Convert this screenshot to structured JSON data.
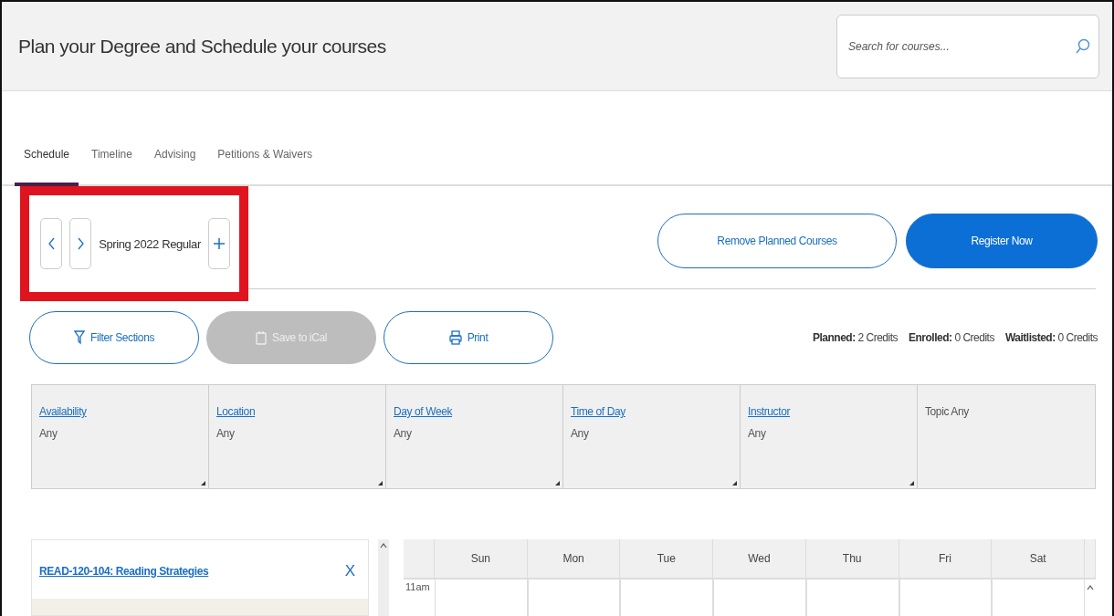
{
  "header": {
    "title": "Plan your Degree and Schedule your courses",
    "search": {
      "placeholder": "Search for courses..."
    }
  },
  "tabs": [
    {
      "label": "Schedule",
      "selected": true
    },
    {
      "label": "Timeline",
      "selected": false
    },
    {
      "label": "Advising",
      "selected": false
    },
    {
      "label": "Petitions & Waivers",
      "selected": false
    }
  ],
  "term": {
    "name": "Spring 2022 Regular",
    "highlighted": true
  },
  "actions": [
    {
      "label": "Remove Planned Courses",
      "kind": "outline"
    },
    {
      "label": "Register Now",
      "kind": "primary"
    }
  ],
  "tools": [
    {
      "label": "Filter Sections",
      "kind": "filter",
      "disabled": false
    },
    {
      "label": "Save to iCal",
      "kind": "calendar",
      "disabled": true
    },
    {
      "label": "Print",
      "kind": "print",
      "disabled": false
    }
  ],
  "credits": [
    "**Planned:** 2 Credits",
    "**Enrolled:** 0 Credits",
    "**Waitlisted:** 0 Credits"
  ],
  "filters": [
    {
      "kind": "link",
      "label": "Availability",
      "value": "Any"
    },
    {
      "kind": "link",
      "label": "Location",
      "value": "Any"
    },
    {
      "kind": "link",
      "label": "Day of Week",
      "value": "Any"
    },
    {
      "kind": "link",
      "label": "Time of Day",
      "value": "Any"
    },
    {
      "kind": "link",
      "label": "Instructor",
      "value": "Any"
    },
    {
      "kind": "plain",
      "label": "Topic Any"
    }
  ],
  "courses": [
    {
      "title": "READ-120-104: Reading Strategies",
      "remove": "X"
    }
  ],
  "calendar": {
    "days": [
      "Sun",
      "Mon",
      "Tue",
      "Wed",
      "Thu",
      "Fri",
      "Sat"
    ],
    "times": [
      "11am"
    ]
  }
}
